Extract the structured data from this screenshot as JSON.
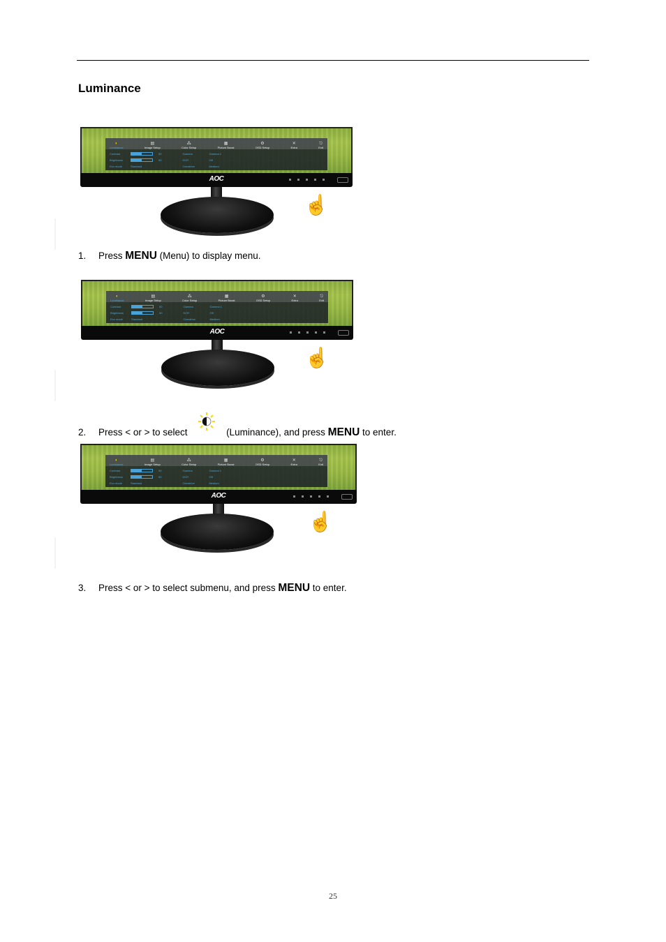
{
  "page": {
    "heading": "Luminance",
    "page_number": "25"
  },
  "figures": [
    {
      "brand_logo": "AOC",
      "osd": {
        "tabs": [
          {
            "label": "Luminance",
            "icon": "luminance-icon",
            "active": true
          },
          {
            "label": "Image Setup",
            "icon": "image-setup-icon",
            "active": false
          },
          {
            "label": "Color Setup",
            "icon": "color-setup-icon",
            "active": false
          },
          {
            "label": "Picture Boost",
            "icon": "picture-boost-icon",
            "active": false
          },
          {
            "label": "OSD Setup",
            "icon": "osd-setup-icon",
            "active": false
          },
          {
            "label": "Extra",
            "icon": "extra-icon",
            "active": false
          },
          {
            "label": "Exit",
            "icon": "exit-icon",
            "active": false
          }
        ],
        "left_items": [
          {
            "label": "Contrast",
            "value": "50",
            "bar_fraction": 0.5
          },
          {
            "label": "Brightness",
            "value": "50",
            "bar_fraction": 0.5
          },
          {
            "label": "Eco mode",
            "value": "Standard"
          }
        ],
        "right_items": [
          {
            "label": "Gamma",
            "value": "Gamma 1"
          },
          {
            "label": "DCR",
            "value": "Off"
          },
          {
            "label": "Overdrive",
            "value": "Medium"
          }
        ]
      }
    }
  ],
  "steps": [
    {
      "number": "1.",
      "pre": "Press ",
      "key": "MENU",
      "post": " (Menu) to display menu."
    },
    {
      "number": "2.",
      "pre": "Press < or >  to select ",
      "icon": "luminance-icon",
      "mid": " (Luminance), and press ",
      "key": "MENU",
      "post": " to enter."
    },
    {
      "number": "3.",
      "pre": "Press < or >  to select submenu, and press ",
      "key": "MENU",
      "post": " to enter."
    }
  ]
}
